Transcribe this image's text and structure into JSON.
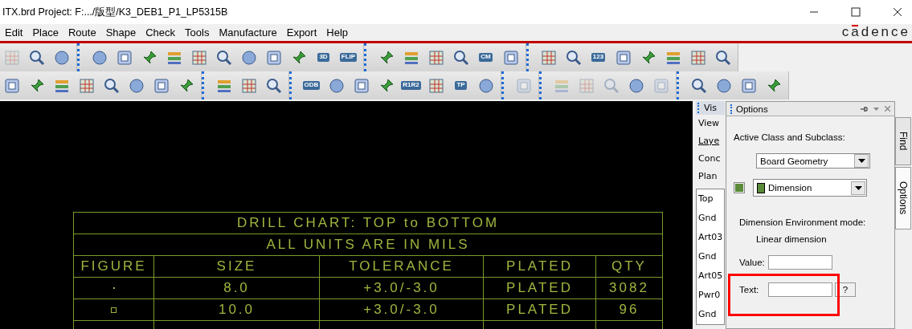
{
  "window": {
    "title": "ITX.brd  Project: F:.../版型/K3_DEB1_P1_LP5315B",
    "logo": "cadence"
  },
  "menu": [
    {
      "label": "Edit"
    },
    {
      "label": "Place"
    },
    {
      "label": "Route"
    },
    {
      "label": "Shape"
    },
    {
      "label": "Check"
    },
    {
      "label": "Tools"
    },
    {
      "label": "Manufacture"
    },
    {
      "label": "Export"
    },
    {
      "label": "Help"
    }
  ],
  "toolbars": [
    [
      [
        {
          "disabled": true
        },
        {
          "disabled": false
        },
        {
          "disabled": false
        }
      ],
      [
        {
          "disabled": false
        },
        {
          "disabled": false
        },
        {
          "disabled": false
        },
        {
          "disabled": false
        },
        {
          "disabled": false
        },
        {
          "disabled": false
        },
        {
          "disabled": false
        },
        {
          "disabled": false
        },
        {
          "disabled": false
        },
        {
          "disabled": false,
          "label": "3D"
        },
        {
          "disabled": false,
          "label": "FLIP"
        }
      ],
      [
        {
          "disabled": false
        },
        {
          "disabled": false
        },
        {
          "disabled": false
        },
        {
          "disabled": false
        },
        {
          "disabled": false,
          "label": "CM"
        },
        {
          "disabled": false
        }
      ],
      [
        {
          "disabled": false
        },
        {
          "disabled": false
        },
        {
          "disabled": false,
          "label": "123"
        },
        {
          "disabled": false
        },
        {
          "disabled": false
        },
        {
          "disabled": false
        },
        {
          "disabled": false
        },
        {
          "disabled": false
        }
      ]
    ],
    [
      [
        {
          "disabled": false
        },
        {
          "disabled": false
        },
        {
          "disabled": false
        },
        {
          "disabled": false
        },
        {
          "disabled": false
        },
        {
          "disabled": false
        },
        {
          "disabled": false
        },
        {
          "disabled": false
        }
      ],
      [
        {
          "disabled": false
        },
        {
          "disabled": false
        },
        {
          "disabled": false
        }
      ],
      [
        {
          "disabled": false,
          "label": "ODB"
        },
        {
          "disabled": false
        },
        {
          "disabled": false
        },
        {
          "disabled": false
        },
        {
          "disabled": false,
          "label": "R1R2"
        },
        {
          "disabled": false
        },
        {
          "disabled": false,
          "label": "TP"
        },
        {
          "disabled": false
        }
      ],
      [
        {
          "disabled": true
        }
      ],
      [
        {
          "disabled": true
        },
        {
          "disabled": true
        },
        {
          "disabled": true
        },
        {
          "disabled": false
        },
        {
          "disabled": true
        }
      ],
      [
        {
          "disabled": false
        },
        {
          "disabled": false
        },
        {
          "disabled": false
        },
        {
          "disabled": false
        }
      ]
    ]
  ],
  "drill_chart": {
    "title": "DRILL CHART: TOP to BOTTOM",
    "subtitle": "ALL UNITS ARE IN MILS",
    "columns": [
      "FIGURE",
      "SIZE",
      "TOLERANCE",
      "PLATED",
      "QTY"
    ],
    "rows": [
      {
        "kind": "dot",
        "size": "8.0",
        "tolerance": "+3.0/-3.0",
        "plated": "PLATED",
        "qty": "3082"
      },
      {
        "kind": "square",
        "size": "10.0",
        "tolerance": "+3.0/-3.0",
        "plated": "PLATED",
        "qty": "96"
      }
    ]
  },
  "visibility_panel": {
    "title": "Vis",
    "labels": [
      "View",
      "Laye",
      "Conc",
      "Plan"
    ],
    "layers": [
      "Top",
      "Gnd",
      "Art03",
      "Gnd",
      "Art05",
      "Pwr0",
      "Gnd"
    ]
  },
  "options_panel": {
    "title": "Options",
    "class_label": "Active Class and Subclass:",
    "class_value": "Board Geometry",
    "subclass_value": "Dimension",
    "mode_label": "Dimension Environment mode:",
    "mode_value": "Linear dimension",
    "value_label": "Value:",
    "text_label": "Text:",
    "help_button": "?"
  },
  "side_tabs": [
    {
      "label": "Find",
      "selected": false
    },
    {
      "label": "Options",
      "selected": true
    }
  ]
}
